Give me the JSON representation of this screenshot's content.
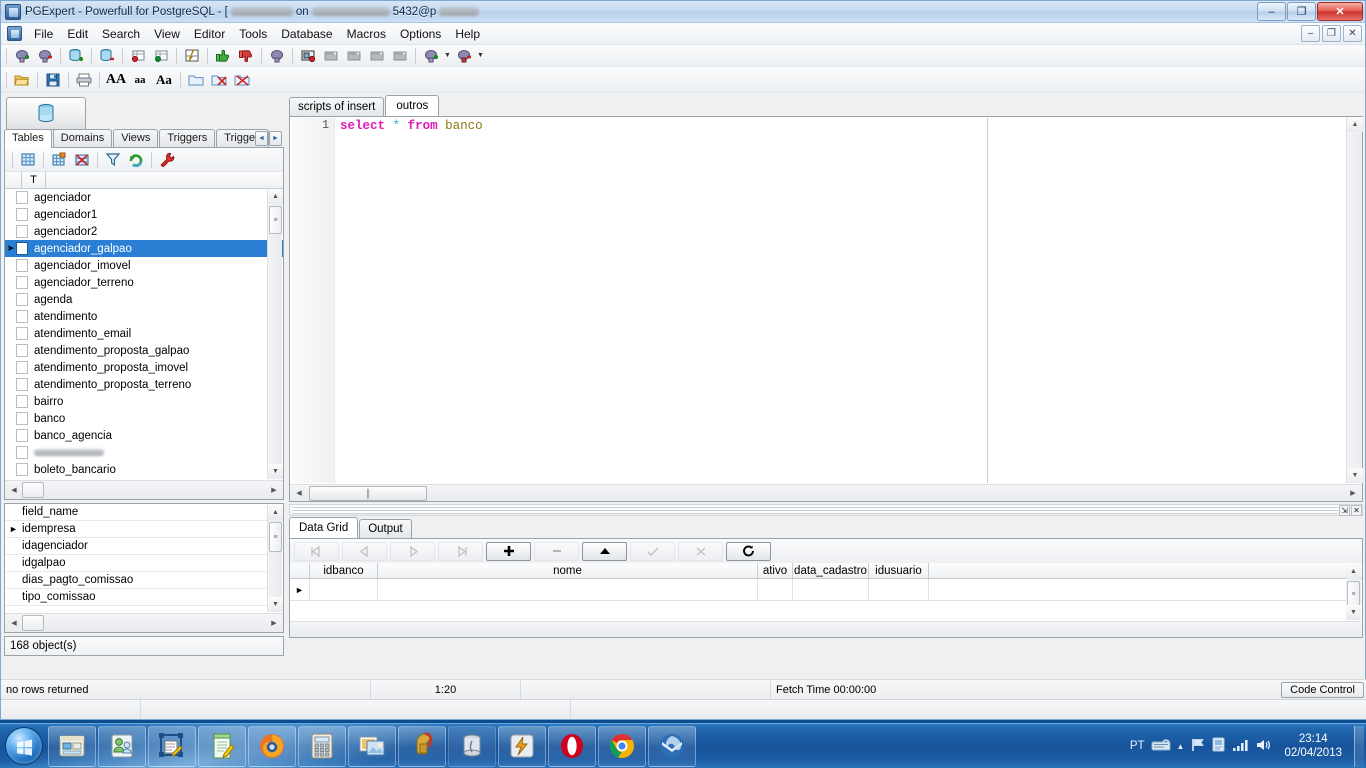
{
  "window": {
    "title_prefix": "PGExpert - Powerfull for PostgreSQL - [",
    "title_on": "on",
    "title_port": "5432@p",
    "minimize": "–",
    "maximize": "❐",
    "close": "✕",
    "mdi_minimize": "–",
    "mdi_restore": "❐",
    "mdi_close": "✕"
  },
  "menu": {
    "items": [
      "File",
      "Edit",
      "Search",
      "View",
      "Editor",
      "Tools",
      "Database",
      "Macros",
      "Options",
      "Help"
    ]
  },
  "toolbar_main": {
    "buttons": [
      {
        "name": "connect-add-icon"
      },
      {
        "name": "connect-remove-icon"
      },
      {
        "name": "database-add-icon"
      },
      {
        "name": "database-remove-icon"
      },
      {
        "name": "sql-new-icon"
      },
      {
        "name": "sql-open-icon"
      },
      {
        "name": "execute-script-icon"
      },
      {
        "name": "commit-icon"
      },
      {
        "name": "rollback-icon"
      },
      {
        "name": "plug-icon"
      },
      {
        "name": "monitor-record-icon"
      },
      {
        "name": "window-1-icon"
      },
      {
        "name": "window-2-icon"
      },
      {
        "name": "window-3-icon"
      },
      {
        "name": "window-4-icon"
      },
      {
        "name": "connect-dropdown-icon"
      },
      {
        "name": "disconnect-dropdown-icon"
      }
    ]
  },
  "toolbar_editor": {
    "buttons": [
      {
        "name": "open-file-icon"
      },
      {
        "name": "save-file-icon"
      },
      {
        "name": "print-icon"
      },
      {
        "name": "font-upper-icon",
        "label": "AA"
      },
      {
        "name": "font-lower-icon",
        "label": "aa"
      },
      {
        "name": "font-mixed-icon",
        "label": "Aa"
      },
      {
        "name": "folder-icon"
      },
      {
        "name": "close-tab-icon"
      },
      {
        "name": "close-all-tabs-icon"
      }
    ]
  },
  "left_panel": {
    "db_button_name": "database-selector-button",
    "object_tabs": [
      {
        "label": "Tables",
        "active": true
      },
      {
        "label": "Domains",
        "active": false
      },
      {
        "label": "Views",
        "active": false
      },
      {
        "label": "Triggers",
        "active": false
      },
      {
        "label": "Trigger Func",
        "active": false
      }
    ],
    "tab_nav_prev": "◄",
    "tab_nav_next": "►",
    "tree_toolbar": [
      {
        "name": "grid-view-icon"
      },
      {
        "name": "new-table-icon"
      },
      {
        "name": "drop-table-icon"
      },
      {
        "name": "filter-icon"
      },
      {
        "name": "refresh-icon"
      },
      {
        "name": "tools-wrench-icon"
      }
    ],
    "tree_header_col": "T",
    "tables": [
      {
        "label": "agenciador",
        "selected": false,
        "redacted": false
      },
      {
        "label": "agenciador1",
        "selected": false,
        "redacted": false
      },
      {
        "label": "agenciador2",
        "selected": false,
        "redacted": false
      },
      {
        "label": "agenciador_galpao",
        "selected": true,
        "redacted": false
      },
      {
        "label": "agenciador_imovel",
        "selected": false,
        "redacted": false
      },
      {
        "label": "agenciador_terreno",
        "selected": false,
        "redacted": false
      },
      {
        "label": "agenda",
        "selected": false,
        "redacted": false
      },
      {
        "label": "atendimento",
        "selected": false,
        "redacted": false
      },
      {
        "label": "atendimento_email",
        "selected": false,
        "redacted": false
      },
      {
        "label": "atendimento_proposta_galpao",
        "selected": false,
        "redacted": false
      },
      {
        "label": "atendimento_proposta_imovel",
        "selected": false,
        "redacted": false
      },
      {
        "label": "atendimento_proposta_terreno",
        "selected": false,
        "redacted": false
      },
      {
        "label": "bairro",
        "selected": false,
        "redacted": false
      },
      {
        "label": "banco",
        "selected": false,
        "redacted": false
      },
      {
        "label": "banco_agencia",
        "selected": false,
        "redacted": false
      },
      {
        "label": "",
        "selected": false,
        "redacted": true
      },
      {
        "label": "boleto_bancario",
        "selected": false,
        "redacted": false
      }
    ],
    "fields_header": "field_name",
    "fields": [
      {
        "label": "idempresa",
        "current": true
      },
      {
        "label": "idagenciador",
        "current": false
      },
      {
        "label": "idgalpao",
        "current": false
      },
      {
        "label": "dias_pagto_comissao",
        "current": false
      },
      {
        "label": "tipo_comissao",
        "current": false
      }
    ],
    "object_count": "168 object(s)"
  },
  "editor": {
    "tabs": [
      {
        "label": "scripts of insert",
        "active": false
      },
      {
        "label": "outros",
        "active": true
      }
    ],
    "line_numbers": [
      "1"
    ],
    "code": {
      "kw1": "select",
      "star": "*",
      "kw2": "from",
      "ident": "banco"
    }
  },
  "dock": {
    "pin_icon": "⇲",
    "close_icon": "✕"
  },
  "grid": {
    "tabs": [
      {
        "label": "Data Grid",
        "active": true
      },
      {
        "label": "Output",
        "active": false
      }
    ],
    "nav_buttons": [
      {
        "name": "first-record-button",
        "glyph": "⏮",
        "state": "disabled"
      },
      {
        "name": "prior-record-button",
        "glyph": "◀",
        "state": "disabled"
      },
      {
        "name": "next-record-button",
        "glyph": "▶",
        "state": "disabled"
      },
      {
        "name": "last-record-button",
        "glyph": "⏭",
        "state": "disabled"
      },
      {
        "name": "insert-record-button",
        "glyph": "✚",
        "state": "enabled"
      },
      {
        "name": "delete-record-button",
        "glyph": "➖",
        "state": "disabled"
      },
      {
        "name": "edit-record-button",
        "glyph": "▲",
        "state": "enabled"
      },
      {
        "name": "post-edit-button",
        "glyph": "✓",
        "state": "disabled"
      },
      {
        "name": "cancel-edit-button",
        "glyph": "✗",
        "state": "disabled"
      },
      {
        "name": "refresh-record-button",
        "glyph": "↻",
        "state": "enabled"
      }
    ],
    "columns": [
      "idbanco",
      "nome",
      "ativo",
      "data_cadastro",
      "idusuario"
    ],
    "rows": []
  },
  "statusbar": {
    "message": "no rows returned",
    "cursor_position": "1:20",
    "fetch_time": "Fetch Time 00:00:00",
    "code_control": "Code Control"
  },
  "taskbar": {
    "start_name": "start-orb-button",
    "items": [
      {
        "name": "taskbar-explorer-icon"
      },
      {
        "name": "taskbar-contacts-icon"
      },
      {
        "name": "taskbar-text-tool-icon"
      },
      {
        "name": "taskbar-notepad-icon"
      },
      {
        "name": "taskbar-firefox-icon"
      },
      {
        "name": "taskbar-calculator-icon"
      },
      {
        "name": "taskbar-photo-viewer-icon"
      },
      {
        "name": "taskbar-helmet-icon"
      },
      {
        "name": "taskbar-database-icon"
      },
      {
        "name": "taskbar-winamp-icon"
      },
      {
        "name": "taskbar-opera-icon"
      },
      {
        "name": "taskbar-chrome-icon"
      },
      {
        "name": "taskbar-thunderbird-icon"
      }
    ],
    "tray": {
      "language": "PT",
      "keyboard_icon": "keyboard-icon",
      "expand_icon": "▲",
      "flag_icon": "action-center-flag-icon",
      "device_icon": "device-icon",
      "network_icon": "network-signal-icon",
      "volume_icon": "volume-icon",
      "time": "23:14",
      "date": "02/04/2013"
    }
  }
}
